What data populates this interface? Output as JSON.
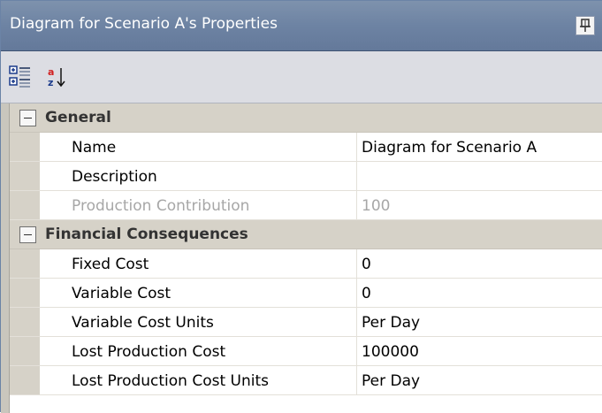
{
  "window": {
    "title": "Diagram for Scenario A's Properties",
    "pin_icon": "pin-icon"
  },
  "toolbar": {
    "categorized_icon": "categorized-view-icon",
    "alphabetical_icon": "alphabetical-sort-icon"
  },
  "colors": {
    "titlebar": "#6d83a3",
    "toolbar": "#dcdde3",
    "category_row": "#d6d2c8",
    "disabled_text": "#a7a7a7"
  },
  "grid": {
    "categories": [
      {
        "label": "General",
        "properties": [
          {
            "name": "Name",
            "value": "Diagram for Scenario A",
            "disabled": false
          },
          {
            "name": "Description",
            "value": "",
            "disabled": false
          },
          {
            "name": "Production Contribution",
            "value": "100",
            "disabled": true
          }
        ]
      },
      {
        "label": "Financial Consequences",
        "properties": [
          {
            "name": "Fixed Cost",
            "value": "0",
            "disabled": false
          },
          {
            "name": "Variable Cost",
            "value": "0",
            "disabled": false
          },
          {
            "name": "Variable Cost Units",
            "value": "Per Day",
            "disabled": false
          },
          {
            "name": "Lost Production Cost",
            "value": "100000",
            "disabled": false
          },
          {
            "name": "Lost Production Cost Units",
            "value": "Per Day",
            "disabled": false
          }
        ]
      }
    ]
  }
}
